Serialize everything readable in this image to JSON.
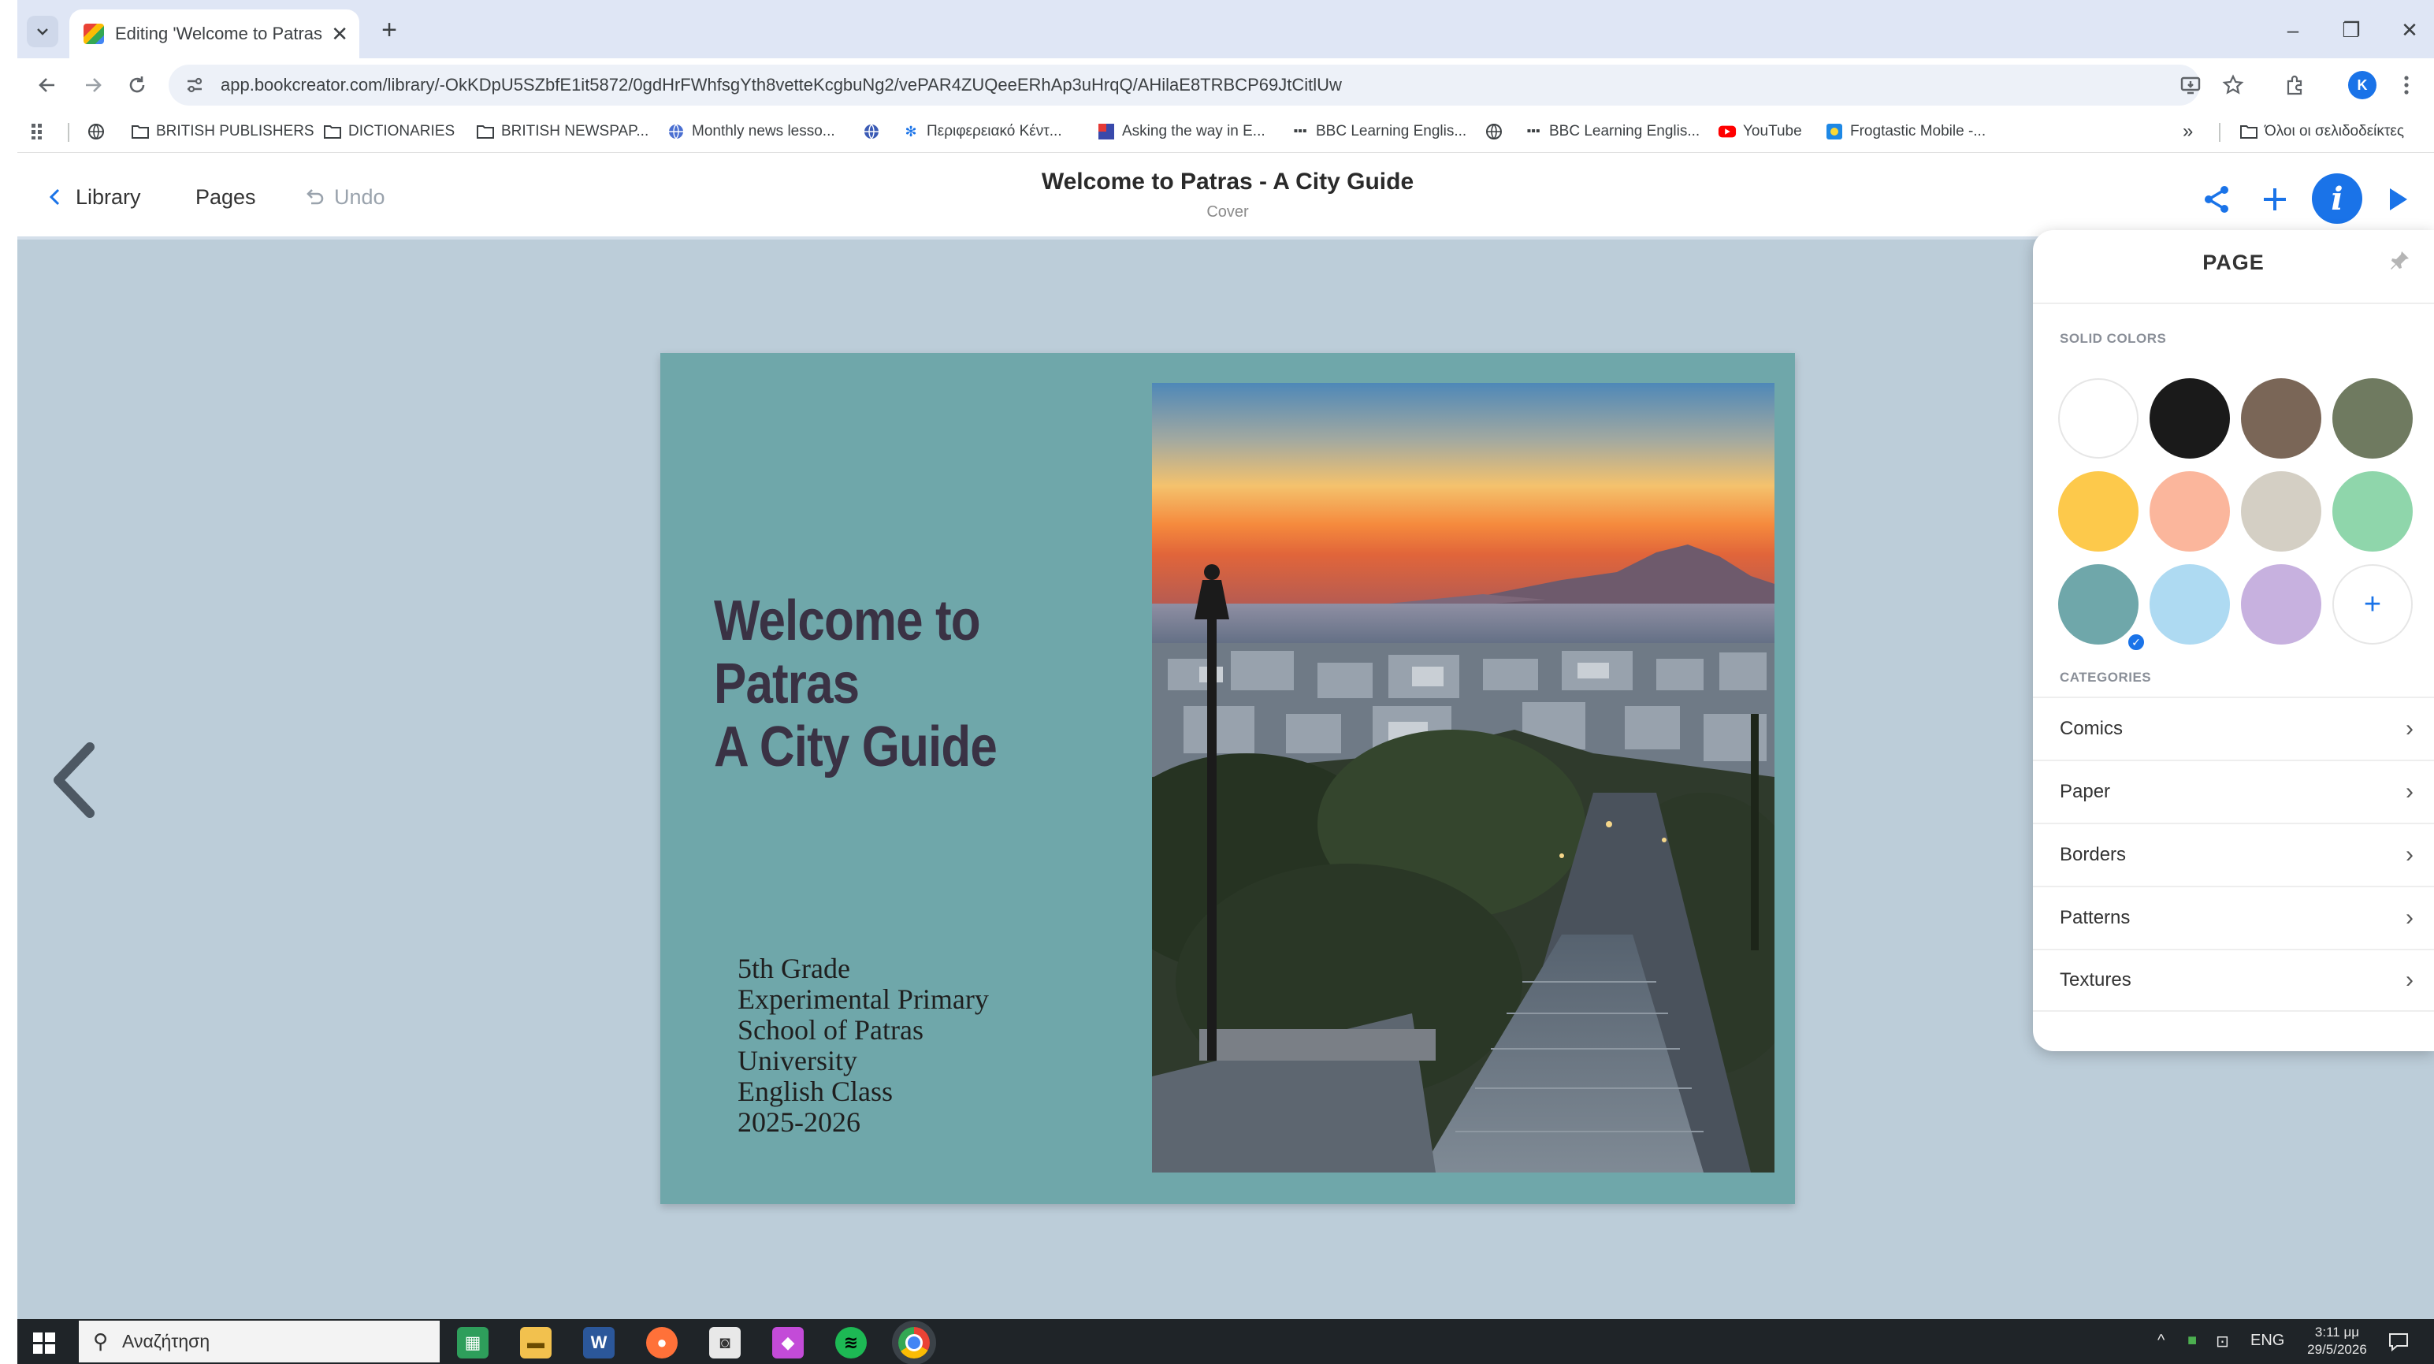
{
  "browser": {
    "tab": {
      "title": "Editing 'Welcome to Patras - A (",
      "close": "✕"
    },
    "new_tab": "+",
    "window_controls": {
      "minimize": "–",
      "restore": "❐",
      "close": "✕"
    },
    "url": "app.bookcreator.com/library/-OkKDpU5SZbfE1it5872/0gdHrFWhfsgYth8vetteKcgbuNg2/vePAR4ZUQeeERhAp3uHrqQ/AHilaE8TRBCP69JtCitlUw",
    "bookmarks": [
      {
        "label": "BRITISH PUBLISHERS",
        "icon": "folder-icon"
      },
      {
        "label": "DICTIONARIES",
        "icon": "folder-icon"
      },
      {
        "label": "BRITISH NEWSPAP...",
        "icon": "folder-icon"
      },
      {
        "label": "Monthly news lesso...",
        "icon": "globe-icon"
      },
      {
        "label": "",
        "icon": "globe-icon"
      },
      {
        "label": "Περιφερειακό Κέντ...",
        "icon": "gear-icon"
      },
      {
        "label": "Asking the way in E...",
        "icon": "site-icon"
      },
      {
        "label": "BBC Learning Englis...",
        "icon": "bbc-icon"
      },
      {
        "label": "",
        "icon": "globe-icon"
      },
      {
        "label": "BBC Learning Englis...",
        "icon": "bbc-icon"
      },
      {
        "label": "YouTube",
        "icon": "youtube-icon"
      },
      {
        "label": "Frogtastic Mobile -...",
        "icon": "site-icon"
      }
    ],
    "bookmarks_overflow": "»",
    "all_bookmarks": "Όλοι οι σελιδοδείκτες",
    "profile_initial": "K"
  },
  "app": {
    "nav": {
      "library": "Library",
      "pages": "Pages",
      "undo": "Undo"
    },
    "book_title": "Welcome to Patras - A City Guide",
    "page_label": "Cover",
    "colors": {
      "accent": "#1a73e8"
    }
  },
  "cover": {
    "title_lines": [
      "Welcome to",
      "Patras",
      "A City Guide"
    ],
    "subtitle_lines": [
      "5th Grade",
      "Experimental Primary",
      "School of Patras",
      "University",
      "English Class",
      "2025-2026"
    ],
    "background": "#6fa7aa"
  },
  "panel": {
    "title": "PAGE",
    "solid_colors_label": "SOLID COLORS",
    "swatches": [
      "#ffffff",
      "#1a1a1a",
      "#7a6657",
      "#6f7a60",
      "#fdc94b",
      "#fbb69c",
      "#d4cfc4",
      "#8fd6ab",
      "#6fa7aa",
      "#aedaf2",
      "#c7b1df"
    ],
    "selected_swatch": 8,
    "add_color": "+",
    "categories_label": "CATEGORIES",
    "categories": [
      "Comics",
      "Paper",
      "Borders",
      "Patterns",
      "Textures"
    ]
  },
  "taskbar": {
    "search_placeholder": "Αναζήτηση",
    "language": "ENG",
    "time": "3:11 μμ",
    "date": "29/5/2026"
  }
}
